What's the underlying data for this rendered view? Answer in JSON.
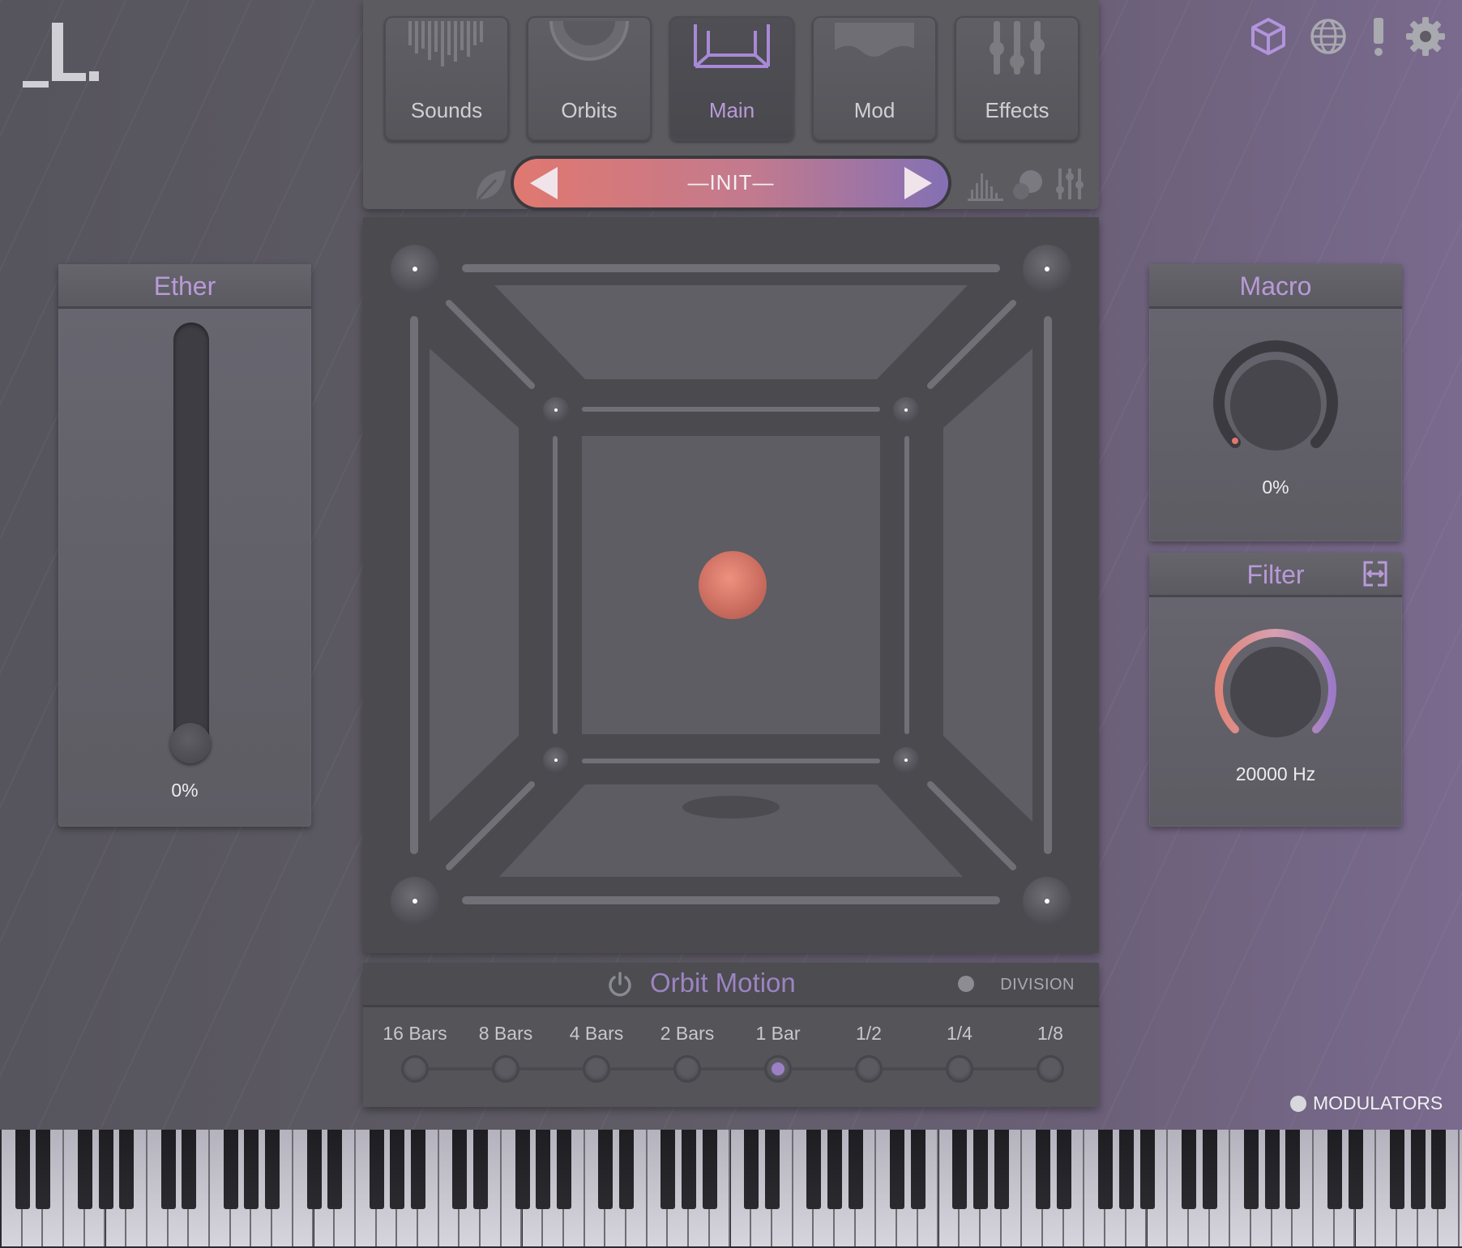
{
  "logo": {
    "text": "_L."
  },
  "top_icons": [
    "cube-icon",
    "globe-icon",
    "alert-icon",
    "gear-icon"
  ],
  "nav": {
    "tabs": [
      {
        "label": "Sounds",
        "icon": "sounds-icon",
        "active": false
      },
      {
        "label": "Orbits",
        "icon": "orbits-icon",
        "active": false
      },
      {
        "label": "Main",
        "icon": "main-icon",
        "active": true
      },
      {
        "label": "Mod",
        "icon": "mod-icon",
        "active": false
      },
      {
        "label": "Effects",
        "icon": "effects-icon",
        "active": false
      }
    ]
  },
  "preset": {
    "name": "—INIT—"
  },
  "ether": {
    "title": "Ether",
    "value": "0%",
    "level": 0
  },
  "macro": {
    "title": "Macro",
    "value": "0%",
    "level": 0
  },
  "filter": {
    "title": "Filter",
    "value": "20000 Hz",
    "level": 1
  },
  "orbit_motion": {
    "title": "Orbit Motion",
    "division_label": "DIVISION",
    "steps": [
      "16 Bars",
      "8 Bars",
      "4 Bars",
      "2 Bars",
      "1 Bar",
      "1/2",
      "1/4",
      "1/8"
    ],
    "selected_index": 4
  },
  "modulators_label": "MODULATORS",
  "colors": {
    "accent": "#b89ad8",
    "orb": "#d9776a",
    "preset_start": "#e07870",
    "preset_end": "#8470b4"
  }
}
